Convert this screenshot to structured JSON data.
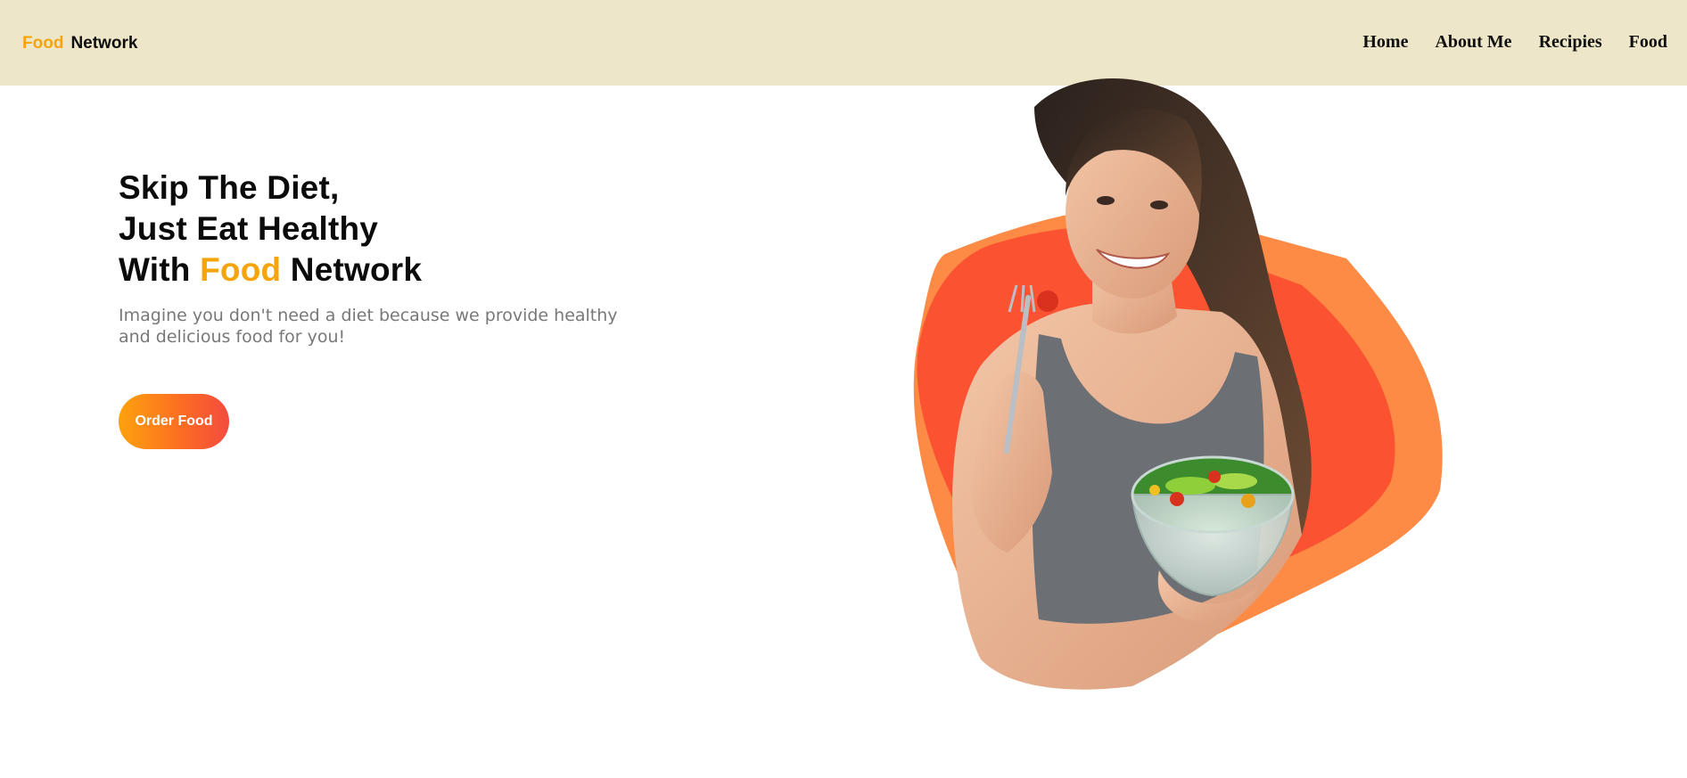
{
  "brand": {
    "first": "Food",
    "second": "Network"
  },
  "nav": {
    "items": [
      {
        "label": "Home"
      },
      {
        "label": "About Me"
      },
      {
        "label": "Recipies"
      },
      {
        "label": "Food"
      }
    ]
  },
  "hero": {
    "line1": "Skip The Diet,",
    "line2": "Just Eat Healthy",
    "line3_prefix": "With",
    "line3_accent": "Food",
    "line3_suffix": "Network",
    "subtitle": "Imagine you don't need a diet because we provide healthy and delicious food for you!",
    "cta_label": "Order Food",
    "image_icon": "woman-eating-salad-image"
  },
  "colors": {
    "accent": "#f5a40d",
    "navbar_bg": "#eee6c9",
    "shape_orange": "#fd8a45",
    "shape_red": "#fb5232",
    "text_dark": "#0b0b0b",
    "text_muted": "#787878"
  }
}
